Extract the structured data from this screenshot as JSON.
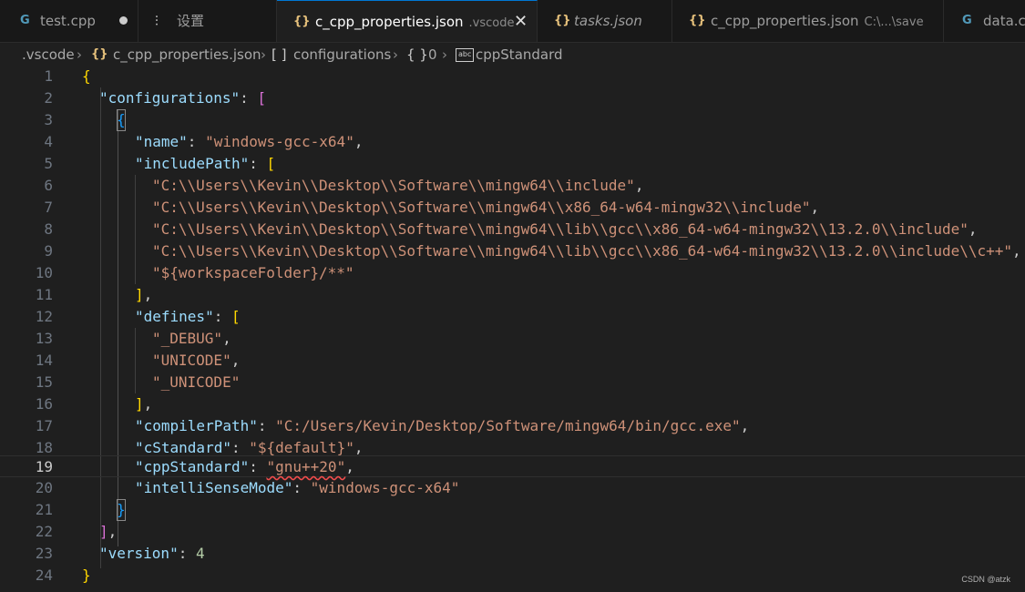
{
  "tabs": [
    {
      "icon": "G",
      "label": "test.cpp",
      "modified": true
    },
    {
      "icon": "⫶",
      "label": "设置"
    },
    {
      "icon": "{}",
      "label": "c_cpp_properties.json",
      "desc": ".vscode",
      "active": true
    },
    {
      "icon": "{}",
      "label": "tasks.json",
      "italic": true
    },
    {
      "icon": "{}",
      "label": "c_cpp_properties.json",
      "desc": "C:\\...\\save"
    },
    {
      "icon": "G",
      "label": "data.cp"
    }
  ],
  "breadcrumbs": {
    "folder": ".vscode",
    "file": "c_cpp_properties.json",
    "configurations": "configurations",
    "index": "0",
    "key": "cppStandard",
    "file_icon": "{}",
    "array_icon": "[ ]",
    "object_icon": "{ }",
    "key_icon": "abc"
  },
  "editor": {
    "current_line": 19,
    "lines": [
      "1",
      "2",
      "3",
      "4",
      "5",
      "6",
      "7",
      "8",
      "9",
      "10",
      "11",
      "12",
      "13",
      "14",
      "15",
      "16",
      "17",
      "18",
      "19",
      "20",
      "21",
      "22",
      "23",
      "24"
    ],
    "tokens": {
      "l1_brace": "{",
      "l2_key": "\"configurations\"",
      "l2_colon": ": ",
      "l2_bracket": "[",
      "l3_brace": "{",
      "l4_key": "\"name\"",
      "l4_colon": ": ",
      "l4_val": "\"windows-gcc-x64\"",
      "l4_comma": ",",
      "l5_key": "\"includePath\"",
      "l5_colon": ": ",
      "l5_bracket": "[",
      "l6_val": "\"C:\\\\Users\\\\Kevin\\\\Desktop\\\\Software\\\\mingw64\\\\include\"",
      "l6_comma": ",",
      "l7_val": "\"C:\\\\Users\\\\Kevin\\\\Desktop\\\\Software\\\\mingw64\\\\x86_64-w64-mingw32\\\\include\"",
      "l7_comma": ",",
      "l8_val": "\"C:\\\\Users\\\\Kevin\\\\Desktop\\\\Software\\\\mingw64\\\\lib\\\\gcc\\\\x86_64-w64-mingw32\\\\13.2.0\\\\include\"",
      "l8_comma": ",",
      "l9_val": "\"C:\\\\Users\\\\Kevin\\\\Desktop\\\\Software\\\\mingw64\\\\lib\\\\gcc\\\\x86_64-w64-mingw32\\\\13.2.0\\\\include\\\\c++\"",
      "l9_comma": ",",
      "l10_val": "\"${workspaceFolder}/**\"",
      "l11_bracket": "]",
      "l11_comma": ",",
      "l12_key": "\"defines\"",
      "l12_colon": ": ",
      "l12_bracket": "[",
      "l13_val": "\"_DEBUG\"",
      "l13_comma": ",",
      "l14_val": "\"UNICODE\"",
      "l14_comma": ",",
      "l15_val": "\"_UNICODE\"",
      "l16_bracket": "]",
      "l16_comma": ",",
      "l17_key": "\"compilerPath\"",
      "l17_colon": ": ",
      "l17_val": "\"C:/Users/Kevin/Desktop/Software/mingw64/bin/gcc.exe\"",
      "l17_comma": ",",
      "l18_key": "\"cStandard\"",
      "l18_colon": ": ",
      "l18_val": "\"${default}\"",
      "l18_comma": ",",
      "l19_key": "\"cppStandard\"",
      "l19_colon": ": ",
      "l19_val": "\"gnu++20\"",
      "l19_comma": ",",
      "l20_key": "\"intelliSenseMode\"",
      "l20_colon": ": ",
      "l20_val": "\"windows-gcc-x64\"",
      "l21_brace": "}",
      "l22_bracket": "]",
      "l22_comma": ",",
      "l23_key": "\"version\"",
      "l23_colon": ": ",
      "l23_val": "4",
      "l24_brace": "}"
    }
  },
  "watermark": "CSDN @atzk",
  "colors": {
    "key": "#9cdcfe",
    "string": "#ce9178",
    "number": "#b5cea8",
    "bracket_1": "#ffd700",
    "bracket_2": "#da70d6",
    "bracket_3": "#179fff",
    "accent": "#0078d4"
  }
}
